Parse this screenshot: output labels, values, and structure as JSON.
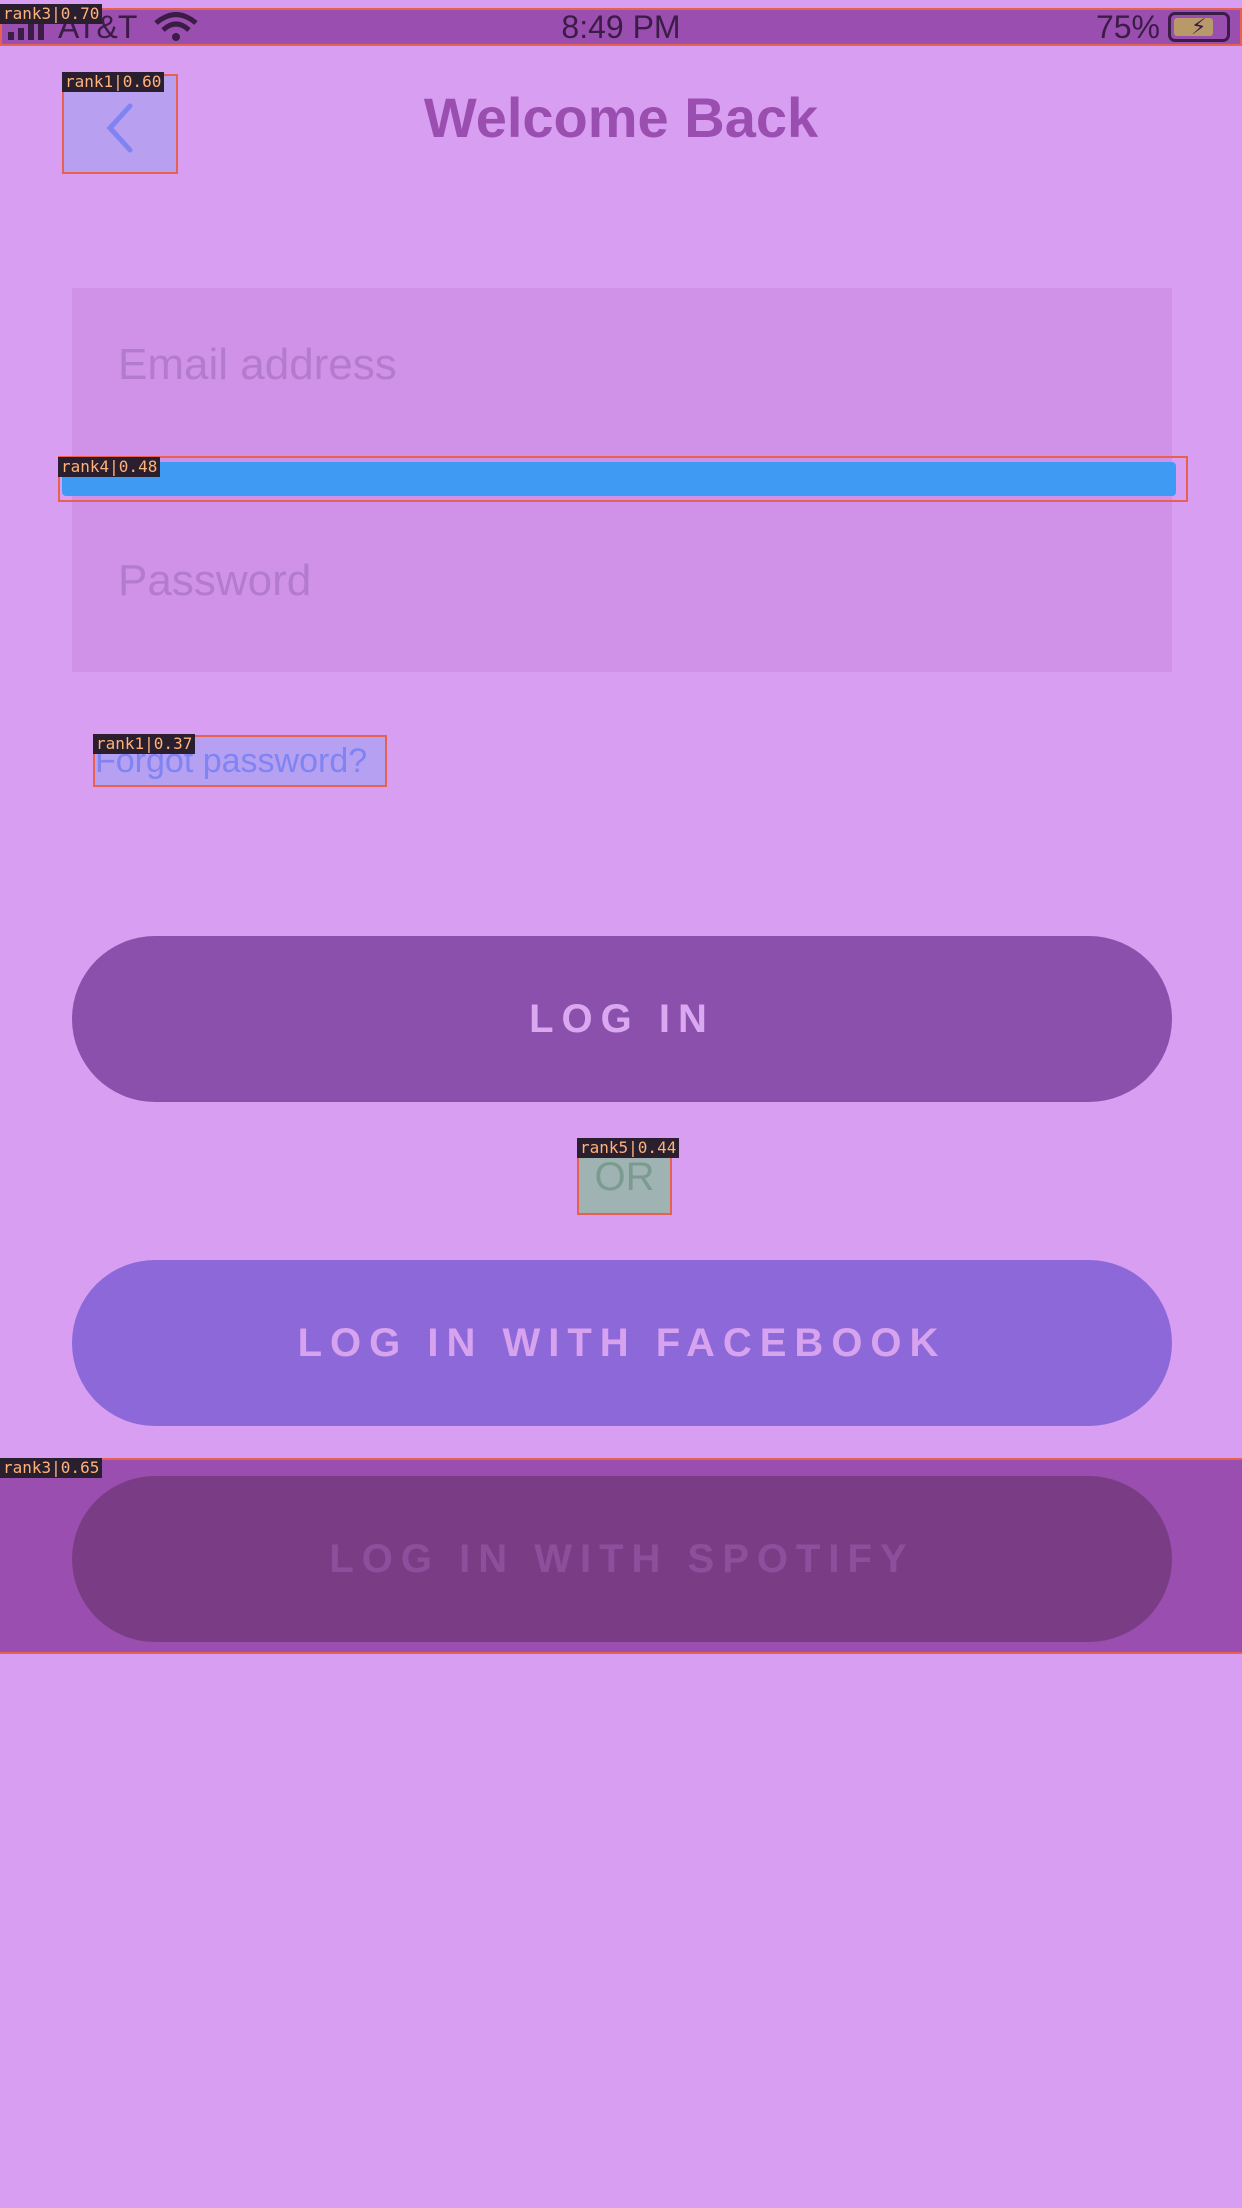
{
  "status_bar": {
    "carrier": "AT&T",
    "time": "8:49 PM",
    "battery": "75%"
  },
  "header": {
    "title": "Welcome Back",
    "back_icon": "chevron-left-icon"
  },
  "form": {
    "email_placeholder": "Email address",
    "password_placeholder": "Password",
    "forgot_password": "Forgot password?"
  },
  "buttons": {
    "login": "LOG IN",
    "or": "OR",
    "facebook": "LOG IN WITH FACEBOOK",
    "spotify": "LOG IN WITH SPOTIFY"
  },
  "annotations": {
    "status_bar": "rank3|0.70",
    "back": "rank1|0.60",
    "focus": "rank4|0.48",
    "forgot": "rank1|0.37",
    "or": "rank5|0.44",
    "spotify": "rank3|0.65"
  },
  "colors": {
    "background": "#d89ef2",
    "annotation_border": "#e8604f",
    "login_button": "#8a50ac",
    "facebook_button": "#8d68d9",
    "focus_bar": "#3f9af3"
  }
}
